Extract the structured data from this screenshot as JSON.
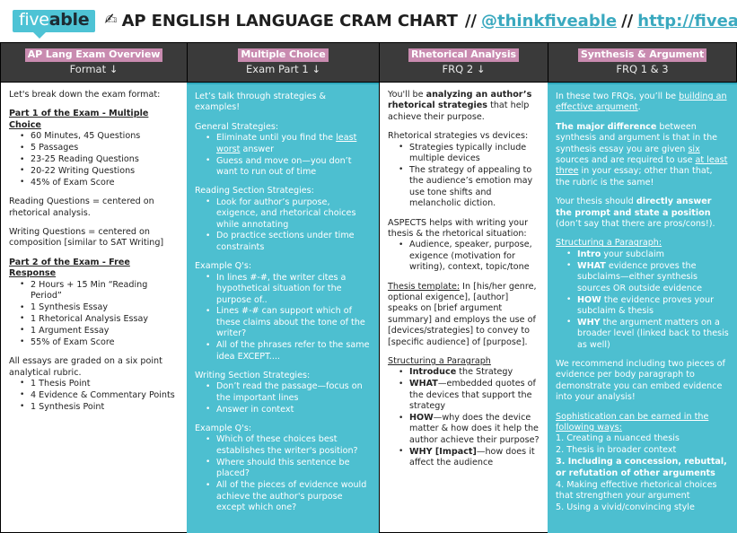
{
  "header": {
    "logo_five": "five",
    "logo_able": "able",
    "pencil_icon": "writing-hand-icon",
    "title": "AP ENGLISH LANGUAGE CRAM CHART",
    "separator1": "//",
    "handle": "@thinkfiveable",
    "separator2": "//",
    "url": "http://fiveable.me"
  },
  "colors": {
    "brand_teal": "#4dbfd0",
    "header_dark": "#3a3a3a",
    "category_pink": "#c98bb0",
    "link_teal": "#3aa9bf"
  },
  "columns": [
    {
      "category": "AP Lang Exam Overview",
      "subtitle": "Format ↓",
      "intro": "Let's break down the exam format:",
      "part1_heading": "Part 1 of the Exam - Multiple Choice",
      "part1_bullets": [
        "60 Minutes, 45 Questions",
        "5 Passages",
        "23-25 Reading Questions",
        "20-22 Writing Questions",
        "45% of Exam Score"
      ],
      "reading_note": "Reading Questions = centered on rhetorical analysis.",
      "writing_note": "Writing Questions = centered on composition [similar to SAT Writing]",
      "part2_heading": "Part 2 of the Exam - Free Response",
      "part2_bullets": [
        "2 Hours + 15 Min “Reading Period”",
        "1 Synthesis Essay",
        "1 Rhetorical Analysis Essay",
        "1 Argument Essay",
        "55% of Exam Score"
      ],
      "rubric_note": "All essays are graded on a six point analytical rubric.",
      "rubric_bullets": [
        "1 Thesis Point",
        "4 Evidence & Commentary Points",
        "1 Synthesis Point"
      ]
    },
    {
      "category": "Multiple Choice",
      "subtitle": "Exam Part 1 ↓",
      "intro": "Let’s talk through strategies & examples!",
      "general_heading": "General Strategies:",
      "general_bullets_a": "Eliminate until you find the ",
      "general_bullets_a_u": "least worst",
      "general_bullets_a_end": " answer",
      "general_bullets_b": "Guess and move on—you don’t want to run out of time",
      "reading_heading": "Reading Section Strategies:",
      "reading_bullets": [
        "Look for author’s purpose, exigence, and rhetorical choices while annotating",
        "Do practice sections under time constraints"
      ],
      "example1_heading": "Example Q's:",
      "example1_bullets": [
        "In lines #-#, the writer cites a hypothetical situation for the purpose of..",
        "Lines #-# can support which of these claims about the tone of the writer?",
        "All of the phrases refer to the same idea EXCEPT...."
      ],
      "writing_heading": "Writing Section Strategies:",
      "writing_bullets": [
        "Don’t read the passage—focus on the important lines",
        "Answer in context"
      ],
      "example2_heading": "Example Q's:",
      "example2_bullets": [
        "Which of these choices best establishes the writer's position?",
        "Where should this sentence be placed?",
        "All of the pieces of evidence would achieve the author's purpose except which one?"
      ]
    },
    {
      "category": "Rhetorical Analysis",
      "subtitle": "FRQ 2 ↓",
      "intro_a": "You'll be ",
      "intro_b": "analyzing an author’s rhetorical strategies",
      "intro_c": " that help achieve their purpose.",
      "devices_heading": "Rhetorical strategies vs devices:",
      "devices_bullets": [
        "Strategies typically include multiple devices",
        "The strategy of appealing to the audience’s emotion may use tone shifts and melancholic diction."
      ],
      "aspects_heading": "ASPECTS helps with writing your thesis & the rhetorical situation:",
      "aspects_bullets": [
        "Audience, speaker, purpose, exigence (motivation for writing), context, topic/tone"
      ],
      "thesis_label": "Thesis template:",
      "thesis_body": " In [his/her genre, optional exigence], [author] speaks on [brief argument summary] and employs the use of [devices/strategies] to convey to [specific audience] of [purpose].",
      "structure_heading": "Structuring a Paragraph",
      "structure_bullets": [
        {
          "bold": "Introduce",
          "rest": " the Strategy"
        },
        {
          "bold": "WHAT",
          "rest": "—embedded quotes of the devices that support the strategy"
        },
        {
          "bold": "HOW",
          "rest": "—why does the device matter & how does it help the author achieve their purpose?"
        },
        {
          "bold": "WHY [Impact]",
          "rest": "—how does it affect the audience"
        }
      ]
    },
    {
      "category": "Synthesis & Argument",
      "subtitle": "FRQ 1 & 3",
      "intro_a": "In these two FRQs, you’ll be ",
      "intro_u": "building an effective argument",
      "intro_b": ".",
      "diff_bold": "The major difference",
      "diff_a": " between synthesis and argument is that in the synthesis essay you are given ",
      "diff_u1": "six",
      "diff_b": " sources and are required to use ",
      "diff_u2": "at least three",
      "diff_c": " in your essay; other than that, the rubric is the same!",
      "thesis_a": "Your thesis should ",
      "thesis_bold": "directly answer the prompt and state a position",
      "thesis_b": " (don’t say that there are pros/cons!).",
      "structure_heading": "Structuring a Paragraph:",
      "structure_bullets": [
        {
          "bold": "Intro",
          "rest": " your subclaim"
        },
        {
          "bold": "WHAT",
          "rest": " evidence proves the subclaims—either synthesis sources OR outside evidence"
        },
        {
          "bold": "HOW",
          "rest": " the evidence proves your subclaim & thesis"
        },
        {
          "bold": "WHY",
          "rest": " the argument matters on a broader level (linked back to thesis as well)"
        }
      ],
      "recommend": "We recommend including two pieces of evidence per body paragraph to demonstrate you can embed evidence into your analysis!",
      "soph_heading": "Sophistication can be earned in the following ways:",
      "soph_items": [
        {
          "text": "Creating a nuanced thesis",
          "bold": false
        },
        {
          "text": "Thesis in broader context",
          "bold": false
        },
        {
          "text": "Including a concession, rebuttal, or refutation of other arguments",
          "bold": true
        },
        {
          "text": "Making effective rhetorical choices that strengthen your argument",
          "bold": false
        },
        {
          "text": "Using a vivid/convincing style",
          "bold": false
        }
      ]
    }
  ]
}
